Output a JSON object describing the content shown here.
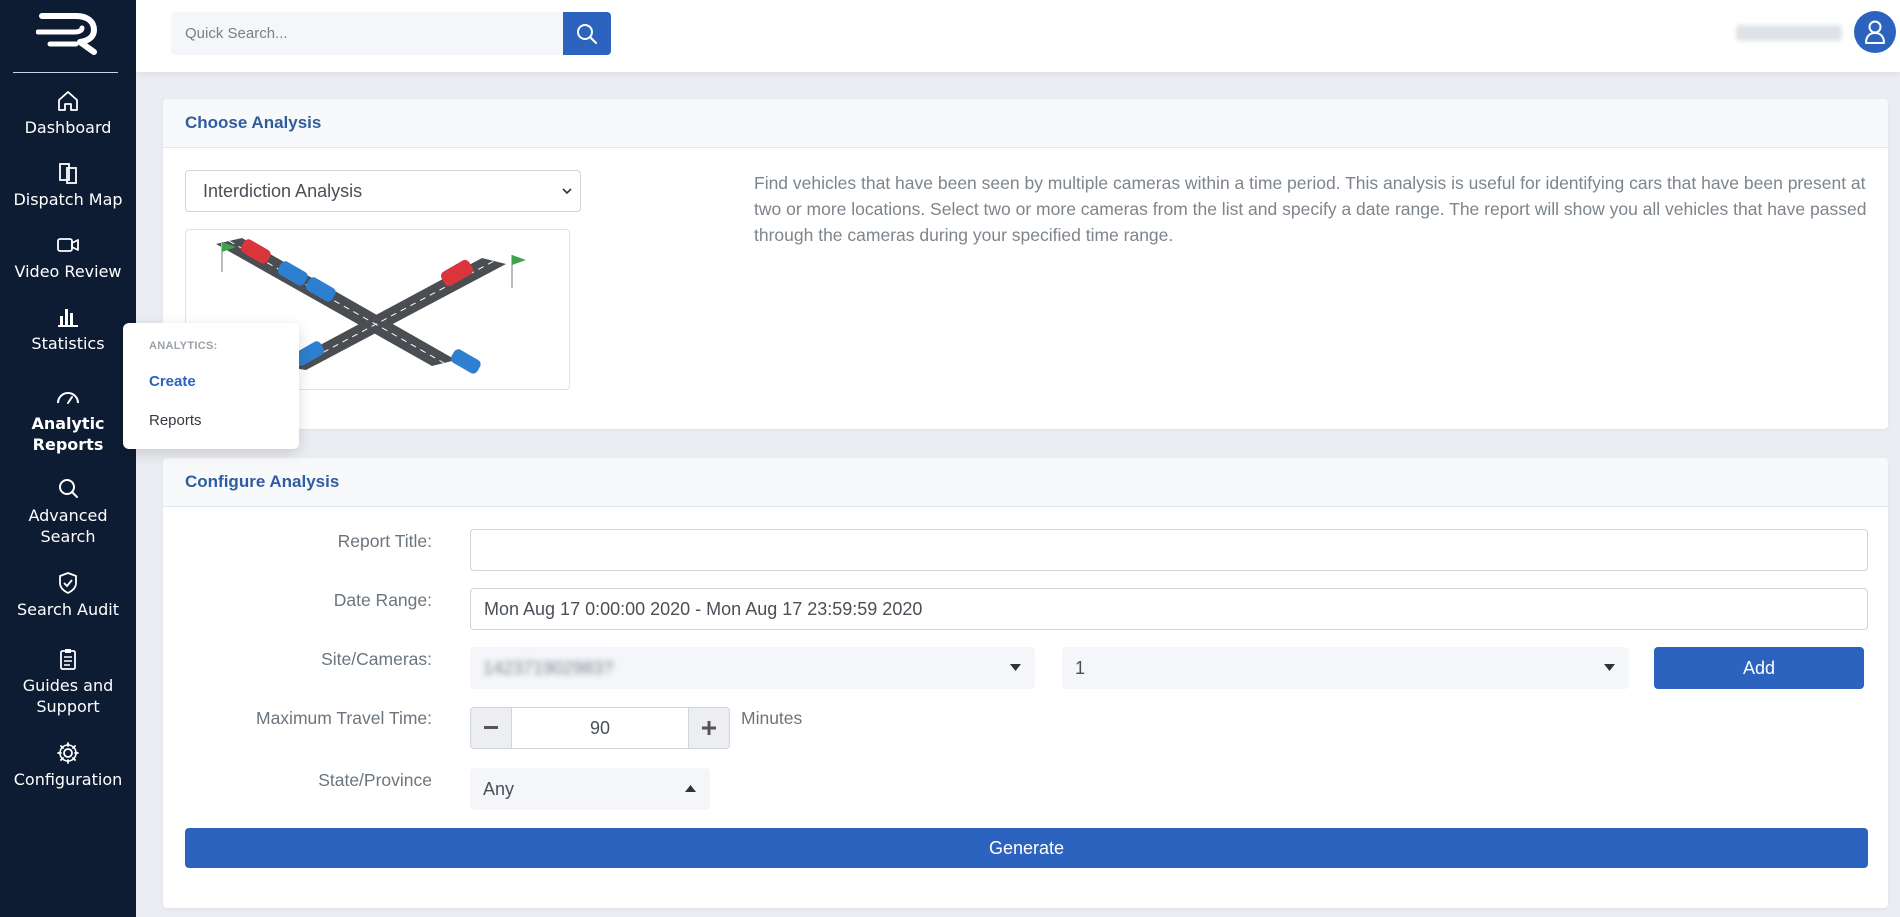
{
  "sidebar": {
    "items": [
      {
        "label_lines": [
          "Dashboard"
        ],
        "icon": "home-icon"
      },
      {
        "label_lines": [
          "Dispatch Map"
        ],
        "icon": "map-icon"
      },
      {
        "label_lines": [
          "Video Review"
        ],
        "icon": "video-camera-icon"
      },
      {
        "label_lines": [
          "Statistics"
        ],
        "icon": "bar-chart-icon"
      },
      {
        "label_lines": [
          "Analytic",
          "Reports"
        ],
        "icon": "gauge-icon",
        "active": true
      },
      {
        "label_lines": [
          "Advanced",
          "Search"
        ],
        "icon": "search-icon"
      },
      {
        "label_lines": [
          "Search Audit"
        ],
        "icon": "shield-check-icon"
      },
      {
        "label_lines": [
          "Guides and",
          "Support"
        ],
        "icon": "clipboard-icon"
      },
      {
        "label_lines": [
          "Configuration"
        ],
        "icon": "gear-icon"
      }
    ]
  },
  "topbar": {
    "search_placeholder": "Quick Search...",
    "user_email": "[redacted]"
  },
  "flyout": {
    "title": "ANALYTICS:",
    "items": [
      {
        "label": "Create",
        "active": true
      },
      {
        "label": "Reports",
        "active": false
      }
    ]
  },
  "choose_analysis": {
    "header": "Choose Analysis",
    "selected": "Interdiction Analysis",
    "description": "Find vehicles that have been seen by multiple cameras within a time period. This analysis is useful for identifying cars that have been present at two or more locations. Select two or more cameras from the list and specify a date range. The report will show you all vehicles that have passed through the cameras during your specified time range."
  },
  "configure_analysis": {
    "header": "Configure Analysis",
    "report_title_label": "Report Title:",
    "report_title_value": "",
    "date_range_label": "Date Range:",
    "date_range_value": "Mon Aug 17 0:00:00 2020 - Mon Aug 17 23:59:59 2020",
    "site_cameras_label": "Site/Cameras:",
    "site_value": "142371902983?",
    "camera_value": "1",
    "add_label": "Add",
    "max_travel_label": "Maximum Travel Time:",
    "max_travel_value": "90",
    "max_travel_unit": "Minutes",
    "state_label": "State/Province",
    "state_value": "Any",
    "generate_label": "Generate"
  },
  "colors": {
    "sidebar_bg": "#0e1c33",
    "accent": "#2b63bf",
    "header_text": "#2f5d9e"
  }
}
